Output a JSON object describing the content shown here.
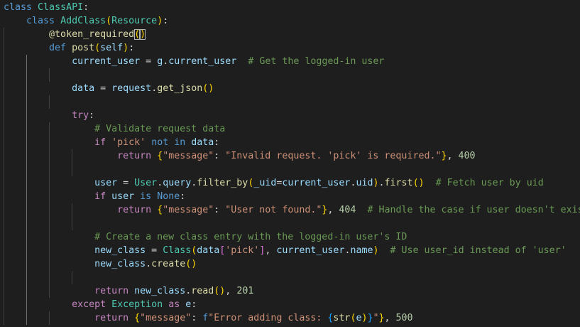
{
  "editor": {
    "language": "python",
    "theme_colors": {
      "background": "#1e1e1e",
      "keyword": "#569cd6",
      "control_keyword": "#c586c0",
      "class_name": "#4ec9b0",
      "function": "#dcdcaa",
      "variable": "#9cdcfe",
      "string": "#ce9178",
      "number": "#b5cea8",
      "comment": "#6a9955",
      "bracket_level1": "#ffd700",
      "bracket_level2": "#da70d6",
      "bracket_level3": "#179fff"
    },
    "lines": [
      [
        [
          "kw",
          "class"
        ],
        [
          "p",
          " "
        ],
        [
          "cls",
          "ClassAPI"
        ],
        [
          "p",
          ":"
        ]
      ],
      [
        [
          "p",
          "    "
        ],
        [
          "kw",
          "class"
        ],
        [
          "p",
          " "
        ],
        [
          "cls",
          "AddClass"
        ],
        [
          "b1",
          "("
        ],
        [
          "cls",
          "Resource"
        ],
        [
          "b1",
          ")"
        ],
        [
          "p",
          ":"
        ]
      ],
      [
        [
          "p",
          "        "
        ],
        [
          "fn",
          "@token_required"
        ],
        [
          "brmatch",
          "("
        ],
        [
          "brmatch",
          ")"
        ]
      ],
      [
        [
          "p",
          "        "
        ],
        [
          "kw",
          "def"
        ],
        [
          "p",
          " "
        ],
        [
          "fn",
          "post"
        ],
        [
          "b1",
          "("
        ],
        [
          "var",
          "self"
        ],
        [
          "b1",
          ")"
        ],
        [
          "p",
          ":"
        ]
      ],
      [
        [
          "p",
          "            "
        ],
        [
          "var",
          "current_user"
        ],
        [
          "p",
          " = "
        ],
        [
          "var",
          "g"
        ],
        [
          "p",
          "."
        ],
        [
          "var",
          "current_user"
        ],
        [
          "p",
          "  "
        ],
        [
          "cmt",
          "# Get the logged-in user"
        ]
      ],
      [],
      [
        [
          "p",
          "            "
        ],
        [
          "var",
          "data"
        ],
        [
          "p",
          " = "
        ],
        [
          "var",
          "request"
        ],
        [
          "p",
          "."
        ],
        [
          "fn",
          "get_json"
        ],
        [
          "b1",
          "("
        ],
        [
          "b1",
          ")"
        ]
      ],
      [],
      [
        [
          "p",
          "            "
        ],
        [
          "flow",
          "try"
        ],
        [
          "p",
          ":"
        ]
      ],
      [
        [
          "p",
          "                "
        ],
        [
          "cmt",
          "# Validate request data"
        ]
      ],
      [
        [
          "p",
          "                "
        ],
        [
          "flow",
          "if"
        ],
        [
          "p",
          " "
        ],
        [
          "str",
          "'pick'"
        ],
        [
          "p",
          " "
        ],
        [
          "kw",
          "not in"
        ],
        [
          "p",
          " "
        ],
        [
          "var",
          "data"
        ],
        [
          "p",
          ":"
        ]
      ],
      [
        [
          "p",
          "                    "
        ],
        [
          "flow",
          "return"
        ],
        [
          "p",
          " "
        ],
        [
          "b1",
          "{"
        ],
        [
          "str",
          "\"message\""
        ],
        [
          "p",
          ": "
        ],
        [
          "str",
          "\"Invalid request. 'pick' is required.\""
        ],
        [
          "b1",
          "}"
        ],
        [
          "p",
          ", "
        ],
        [
          "num",
          "400"
        ]
      ],
      [],
      [
        [
          "p",
          "                "
        ],
        [
          "var",
          "user"
        ],
        [
          "p",
          " = "
        ],
        [
          "cls",
          "User"
        ],
        [
          "p",
          "."
        ],
        [
          "var",
          "query"
        ],
        [
          "p",
          "."
        ],
        [
          "fn",
          "filter_by"
        ],
        [
          "b1",
          "("
        ],
        [
          "var",
          "_uid"
        ],
        [
          "p",
          "="
        ],
        [
          "var",
          "current_user"
        ],
        [
          "p",
          "."
        ],
        [
          "var",
          "uid"
        ],
        [
          "b1",
          ")"
        ],
        [
          "p",
          "."
        ],
        [
          "fn",
          "first"
        ],
        [
          "b1",
          "("
        ],
        [
          "b1",
          ")"
        ],
        [
          "p",
          "  "
        ],
        [
          "cmt",
          "# Fetch user by uid"
        ]
      ],
      [
        [
          "p",
          "                "
        ],
        [
          "flow",
          "if"
        ],
        [
          "p",
          " "
        ],
        [
          "var",
          "user"
        ],
        [
          "p",
          " "
        ],
        [
          "kw",
          "is"
        ],
        [
          "p",
          " "
        ],
        [
          "kw",
          "None"
        ],
        [
          "p",
          ":"
        ]
      ],
      [
        [
          "p",
          "                    "
        ],
        [
          "flow",
          "return"
        ],
        [
          "p",
          " "
        ],
        [
          "b1",
          "{"
        ],
        [
          "str",
          "\"message\""
        ],
        [
          "p",
          ": "
        ],
        [
          "str",
          "\"User not found.\""
        ],
        [
          "b1",
          "}"
        ],
        [
          "p",
          ", "
        ],
        [
          "num",
          "404"
        ],
        [
          "p",
          "  "
        ],
        [
          "cmt",
          "# Handle the case if user doesn't exist"
        ]
      ],
      [],
      [
        [
          "p",
          "                "
        ],
        [
          "cmt",
          "# Create a new class entry with the logged-in user's ID"
        ]
      ],
      [
        [
          "p",
          "                "
        ],
        [
          "var",
          "new_class"
        ],
        [
          "p",
          " = "
        ],
        [
          "cls",
          "Class"
        ],
        [
          "b1",
          "("
        ],
        [
          "var",
          "data"
        ],
        [
          "b2",
          "["
        ],
        [
          "str",
          "'pick'"
        ],
        [
          "b2",
          "]"
        ],
        [
          "p",
          ", "
        ],
        [
          "var",
          "current_user"
        ],
        [
          "p",
          "."
        ],
        [
          "var",
          "name"
        ],
        [
          "b1",
          ")"
        ],
        [
          "p",
          "  "
        ],
        [
          "cmt",
          "# Use user_id instead of 'user'"
        ]
      ],
      [
        [
          "p",
          "                "
        ],
        [
          "var",
          "new_class"
        ],
        [
          "p",
          "."
        ],
        [
          "fn",
          "create"
        ],
        [
          "b1",
          "("
        ],
        [
          "b1",
          ")"
        ]
      ],
      [],
      [
        [
          "p",
          "                "
        ],
        [
          "flow",
          "return"
        ],
        [
          "p",
          " "
        ],
        [
          "var",
          "new_class"
        ],
        [
          "p",
          "."
        ],
        [
          "fn",
          "read"
        ],
        [
          "b1",
          "("
        ],
        [
          "b1",
          ")"
        ],
        [
          "p",
          ", "
        ],
        [
          "num",
          "201"
        ]
      ],
      [
        [
          "p",
          "            "
        ],
        [
          "flow",
          "except"
        ],
        [
          "p",
          " "
        ],
        [
          "cls",
          "Exception"
        ],
        [
          "p",
          " "
        ],
        [
          "flow",
          "as"
        ],
        [
          "p",
          " "
        ],
        [
          "var",
          "e"
        ],
        [
          "p",
          ":"
        ]
      ],
      [
        [
          "p",
          "                "
        ],
        [
          "flow",
          "return"
        ],
        [
          "p",
          " "
        ],
        [
          "b1",
          "{"
        ],
        [
          "str",
          "\"message\""
        ],
        [
          "p",
          ": "
        ],
        [
          "kw",
          "f"
        ],
        [
          "str",
          "\"Error adding class: "
        ],
        [
          "b3",
          "{"
        ],
        [
          "fn",
          "str"
        ],
        [
          "b1",
          "("
        ],
        [
          "var",
          "e"
        ],
        [
          "b1",
          ")"
        ],
        [
          "b3",
          "}"
        ],
        [
          "str",
          "\""
        ],
        [
          "b1",
          "}"
        ],
        [
          "p",
          ", "
        ],
        [
          "num",
          "500"
        ]
      ]
    ]
  }
}
